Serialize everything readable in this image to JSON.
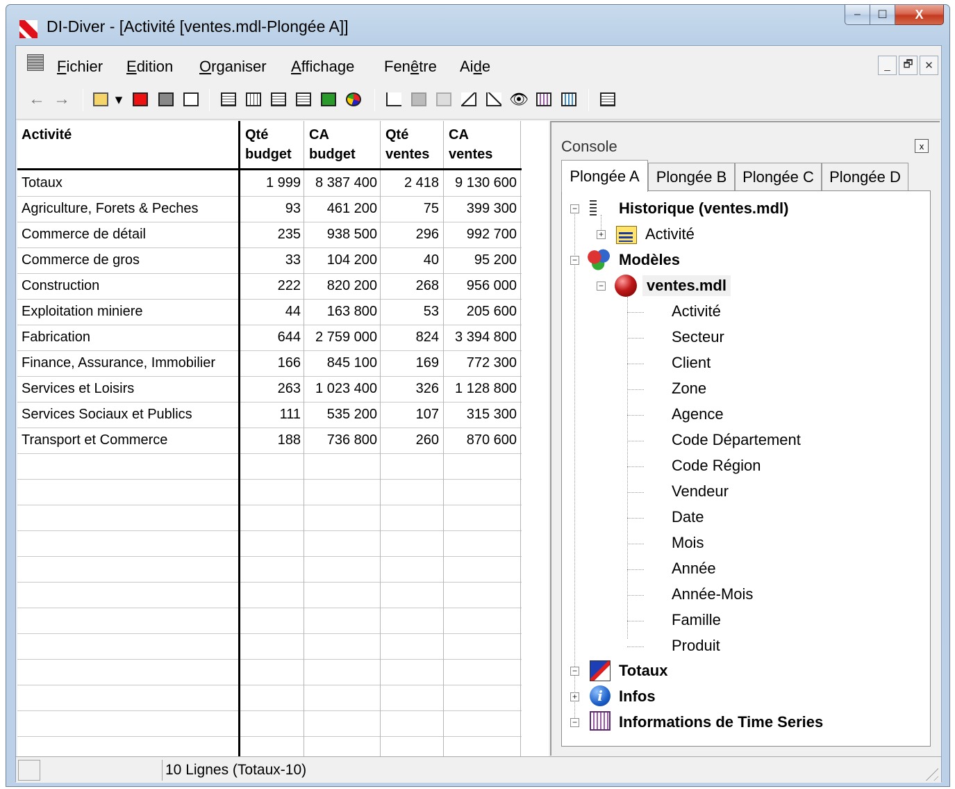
{
  "window": {
    "title": "DI-Diver - [Activité [ventes.mdl-Plongée A]]",
    "min_glyph": "–",
    "max_glyph": "☐",
    "close_glyph": "X"
  },
  "menu": [
    {
      "pre": "",
      "u": "F",
      "post": "ichier"
    },
    {
      "pre": "",
      "u": "E",
      "post": "dition"
    },
    {
      "pre": "",
      "u": "O",
      "post": "rganiser"
    },
    {
      "pre": "",
      "u": "A",
      "post": "ffichage"
    },
    {
      "pre": "Fen",
      "u": "ê",
      "post": "tre"
    },
    {
      "pre": "Ai",
      "u": "d",
      "post": "e"
    }
  ],
  "mdi_caps": [
    "_",
    "🗗",
    "✕"
  ],
  "toolbar": {
    "back_glyph": "←",
    "forward_glyph": "→",
    "dropdown_glyph": "▾",
    "binoculars_glyph": "👁"
  },
  "table": {
    "headers": [
      [
        "Activité",
        ""
      ],
      [
        "Qté",
        "budget"
      ],
      [
        "CA",
        "budget"
      ],
      [
        "Qté",
        "ventes"
      ],
      [
        "CA",
        "ventes"
      ]
    ],
    "rows": [
      [
        "Totaux",
        "1 999",
        "8 387 400",
        "2 418",
        "9 130 600"
      ],
      [
        "Agriculture, Forets & Peches",
        "93",
        "461 200",
        "75",
        "399 300"
      ],
      [
        "Commerce de détail",
        "235",
        "938 500",
        "296",
        "992 700"
      ],
      [
        "Commerce de gros",
        "33",
        "104 200",
        "40",
        "95 200"
      ],
      [
        "Construction",
        "222",
        "820 200",
        "268",
        "956 000"
      ],
      [
        "Exploitation miniere",
        "44",
        "163 800",
        "53",
        "205 600"
      ],
      [
        "Fabrication",
        "644",
        "2 759 000",
        "824",
        "3 394 800"
      ],
      [
        "Finance, Assurance, Immobilier",
        "166",
        "845 100",
        "169",
        "772 300"
      ],
      [
        "Services et Loisirs",
        "263",
        "1 023 400",
        "326",
        "1 128 800"
      ],
      [
        "Services Sociaux et Publics",
        "111",
        "535 200",
        "107",
        "315 300"
      ],
      [
        "Transport et Commerce",
        "188",
        "736 800",
        "260",
        "870 600"
      ]
    ]
  },
  "console": {
    "title": "Console",
    "close_glyph": "x",
    "tabs": [
      "Plongée A",
      "Plongée B",
      "Plongée C",
      "Plongée D"
    ],
    "active_tab": 0,
    "tree": {
      "historique": "Historique (ventes.mdl)",
      "historique_child": "Activité",
      "modeles": "Modèles",
      "model": "ventes.mdl",
      "dimensions": [
        "Activité",
        "Secteur",
        "Client",
        "Zone",
        "Agence",
        "Code Département",
        "Code Région",
        "Vendeur",
        "Date",
        "Mois",
        "Année",
        "Année-Mois",
        "Famille",
        "Produit"
      ],
      "totaux": "Totaux",
      "infos": "Infos",
      "time_series": "Informations de Time Series",
      "info_glyph": "i",
      "expand_plus": "+",
      "expand_minus": "−"
    }
  },
  "status": {
    "text": "10 Lignes (Totaux-10)"
  }
}
